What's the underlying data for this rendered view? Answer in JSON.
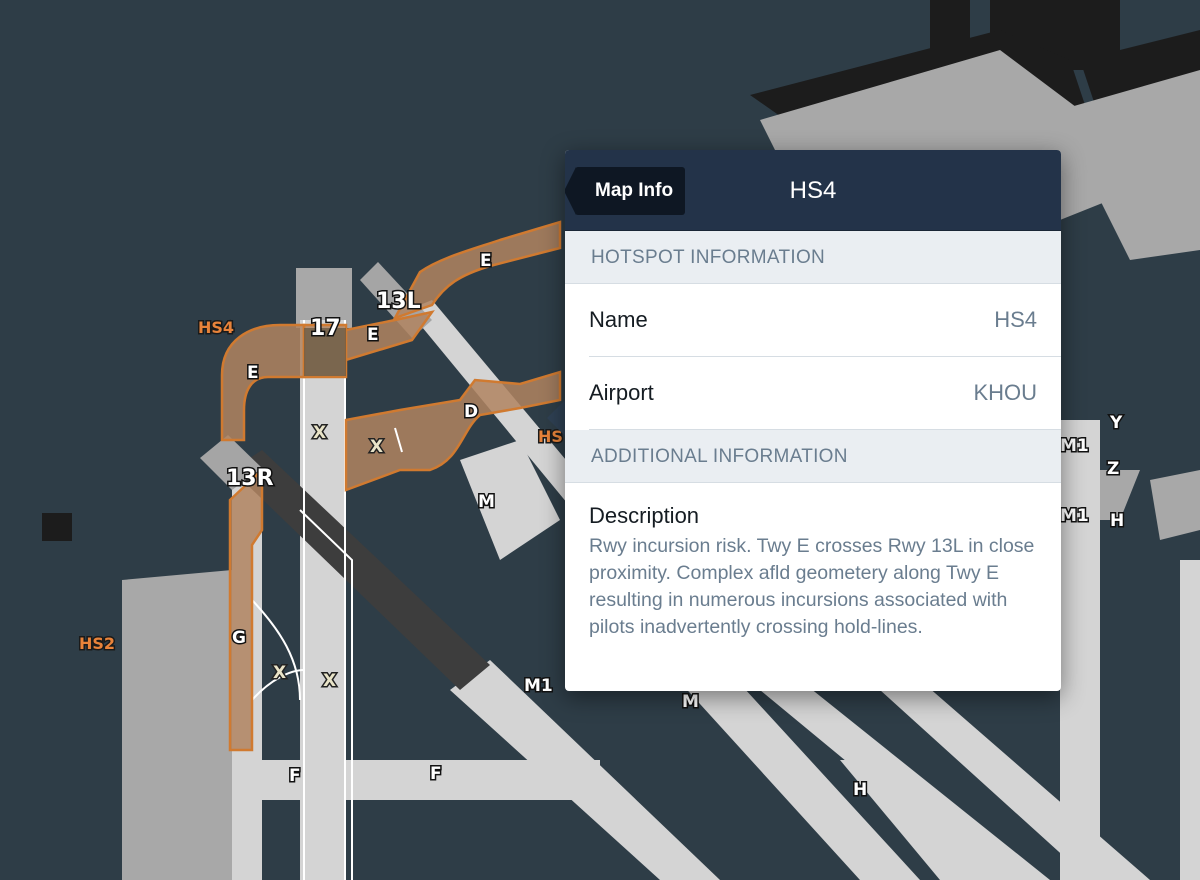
{
  "map": {
    "runways": [
      {
        "label": "13L"
      },
      {
        "label": "13R"
      },
      {
        "label": "17"
      }
    ],
    "taxiways": [
      "E",
      "E",
      "E",
      "D",
      "M",
      "M",
      "M1",
      "M1",
      "M1",
      "G",
      "F",
      "F",
      "H",
      "H",
      "Y",
      "Z"
    ],
    "closed_marks": [
      "X",
      "X",
      "X",
      "X"
    ],
    "hotspots": [
      "HS4",
      "HS2",
      "HS"
    ],
    "colors": {
      "background": "#2e3d47",
      "runway": "#3a3a3a",
      "taxiway": "#d6d6d6",
      "apron": "#a5a5a5",
      "building": "#1a1a1a",
      "hotspot_fill": "#c79b72",
      "hotspot_stroke": "#d07a30"
    }
  },
  "panel": {
    "back_label": "Map Info",
    "title": "HS4",
    "sections": {
      "hotspot": {
        "header": "HOTSPOT INFORMATION",
        "rows": [
          {
            "label": "Name",
            "value": "HS4"
          },
          {
            "label": "Airport",
            "value": "KHOU"
          }
        ]
      },
      "additional": {
        "header": "ADDITIONAL INFORMATION",
        "description_label": "Description",
        "description_text": "Rwy incursion risk. Twy E crosses Rwy 13L in close proximity. Complex afld geometery along Twy E resulting in numerous incursions associated with pilots inadvertently crossing hold-lines."
      }
    }
  }
}
